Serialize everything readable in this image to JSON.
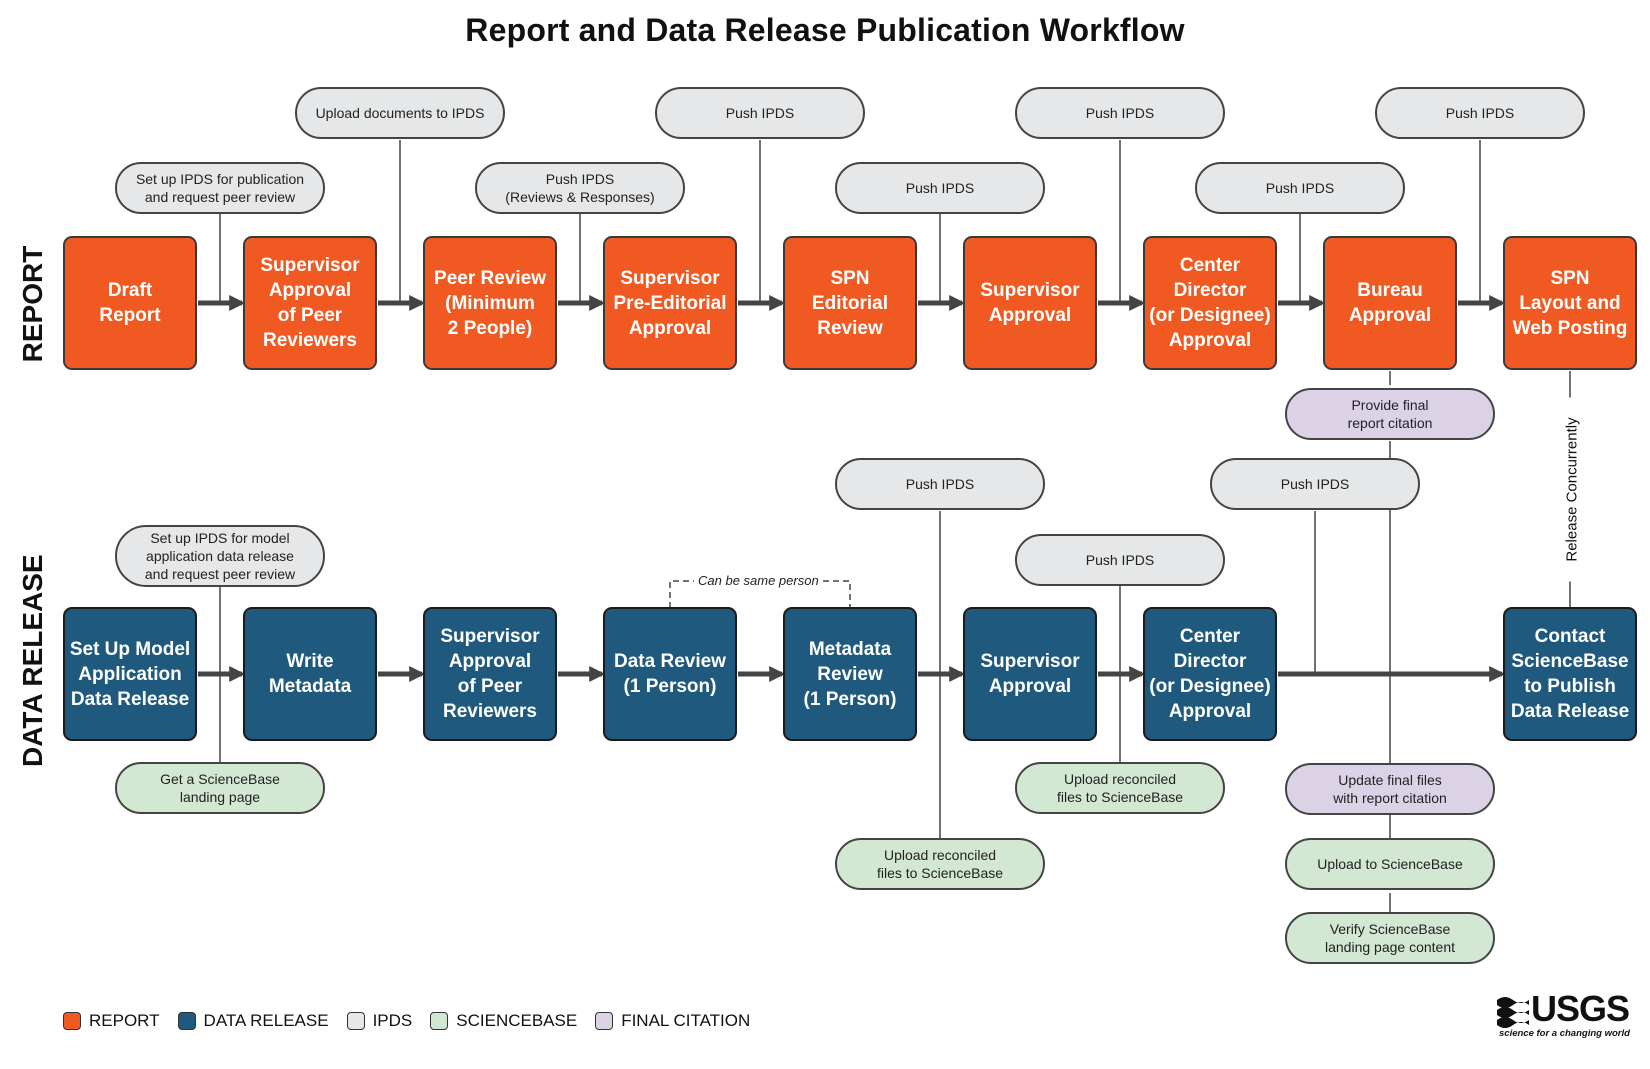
{
  "title": "Report and Data Release Publication Workflow",
  "row_labels": {
    "report": "REPORT",
    "data": "DATA RELEASE"
  },
  "report_steps": [
    "Draft\nReport",
    "Supervisor\nApproval\nof Peer\nReviewers",
    "Peer Review\n(Minimum\n2 People)",
    "Supervisor\nPre-Editorial\nApproval",
    "SPN\nEditorial\nReview",
    "Supervisor\nApproval",
    "Center\nDirector\n(or Designee)\nApproval",
    "Bureau\nApproval",
    "SPN\nLayout and\nWeb Posting"
  ],
  "data_steps": [
    "Set Up Model\nApplication\nData Release",
    "Write\nMetadata",
    "Supervisor\nApproval\nof Peer\nReviewers",
    "Data Review\n(1 Person)",
    "Metadata\nReview\n(1 Person)",
    "Supervisor\nApproval",
    "Center\nDirector\n(or Designee)\nApproval",
    "Contact\nScienceBase\nto Publish\nData Release"
  ],
  "ipds_notes": {
    "r_setup": "Set up IPDS for publication\nand request peer review",
    "r_upload": "Upload documents to IPDS",
    "r_push_reviews": "Push IPDS\n(Reviews & Responses)",
    "r_push_4": "Push IPDS",
    "r_push_5": "Push IPDS",
    "r_push_6": "Push IPDS",
    "r_push_7": "Push IPDS",
    "r_push_8": "Push IPDS",
    "d_setup": "Set up IPDS for model\napplication data release\nand request peer review",
    "d_push_5": "Push IPDS",
    "d_push_6": "Push IPDS",
    "d_push_7": "Push IPDS"
  },
  "sciencebase_notes": {
    "landing": "Get a ScienceBase\nlanding page",
    "upload_reconciled_1": "Upload reconciled\nfiles to ScienceBase",
    "upload_reconciled_2": "Upload reconciled\nfiles to ScienceBase",
    "upload": "Upload to ScienceBase",
    "verify": "Verify ScienceBase\nlanding page content"
  },
  "citation_notes": {
    "provide": "Provide final\nreport citation",
    "update": "Update final files\nwith report citation"
  },
  "annotations": {
    "same_person": "Can be same person",
    "concurrent": "Release Concurrently"
  },
  "legend": [
    {
      "label": "REPORT",
      "color": "#f05a22"
    },
    {
      "label": "DATA RELEASE",
      "color": "#1f5a7e"
    },
    {
      "label": "IPDS",
      "color": "#e6e7e8"
    },
    {
      "label": "SCIENCEBASE",
      "color": "#d3e8d3"
    },
    {
      "label": "FINAL CITATION",
      "color": "#dcd2e6"
    }
  ],
  "logo": {
    "text": "USGS",
    "tagline": "science for a changing world"
  },
  "colors": {
    "report": "#f05a22",
    "data": "#1f5a7e",
    "ipds": "#e6e7e8",
    "sciencebase": "#d3e8d3",
    "citation": "#dcd2e6"
  }
}
